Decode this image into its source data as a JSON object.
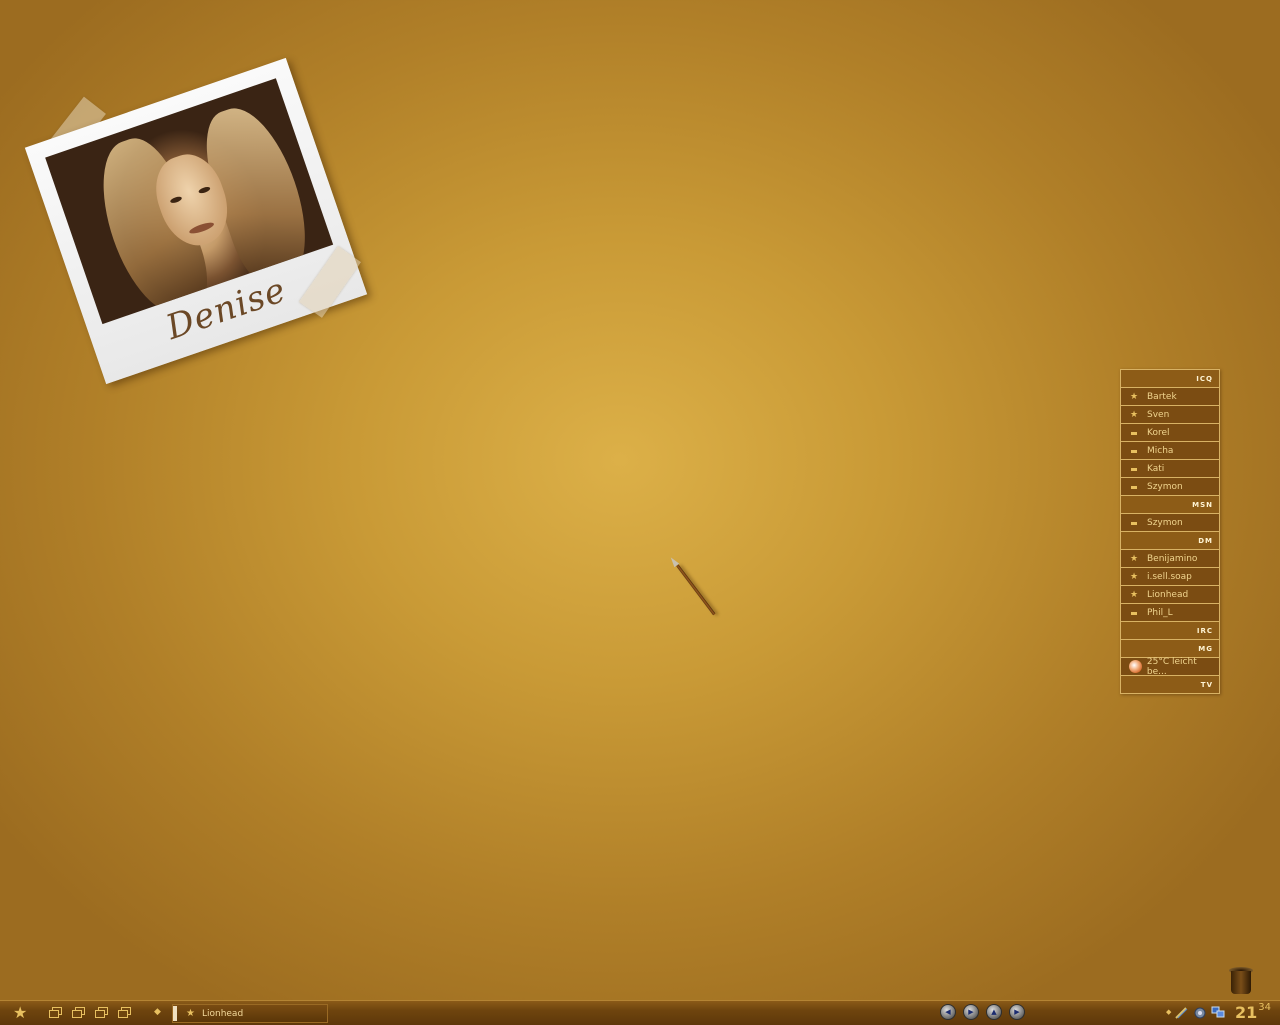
{
  "desktop": {
    "photo_caption": "Denise"
  },
  "contacts": {
    "rows": [
      {
        "type": "header",
        "label": "ICQ"
      },
      {
        "type": "contact",
        "status": "star",
        "name": "Bartek"
      },
      {
        "type": "contact",
        "status": "star",
        "name": "Sven"
      },
      {
        "type": "contact",
        "status": "away",
        "name": "Korel"
      },
      {
        "type": "contact",
        "status": "away",
        "name": "Micha"
      },
      {
        "type": "contact",
        "status": "away",
        "name": "Kati"
      },
      {
        "type": "contact",
        "status": "away",
        "name": "Szymon"
      },
      {
        "type": "header",
        "label": "MSN"
      },
      {
        "type": "contact",
        "status": "away",
        "name": "Szymon"
      },
      {
        "type": "header",
        "label": "DM"
      },
      {
        "type": "contact",
        "status": "star",
        "name": "Benijamino"
      },
      {
        "type": "contact",
        "status": "star",
        "name": "i.sell.soap"
      },
      {
        "type": "contact",
        "status": "star",
        "name": "Lionhead"
      },
      {
        "type": "contact",
        "status": "away",
        "name": "Phil_L"
      },
      {
        "type": "header",
        "label": "IRC"
      },
      {
        "type": "header",
        "label": "MG"
      },
      {
        "type": "weather",
        "name": "25°C leicht be..."
      },
      {
        "type": "header",
        "label": "TV"
      }
    ]
  },
  "taskbar": {
    "active_task": "Lionhead",
    "clock_hours": "21",
    "clock_minutes": "34",
    "icons": {
      "start": "star-icon",
      "desktops": "virtual-desktop-icon",
      "media": [
        "previous-icon",
        "play-icon",
        "eject-icon",
        "next-icon"
      ],
      "trash": "trash-bin-icon"
    }
  },
  "colors": {
    "accent": "#e8c060",
    "panel": "#7b4c12",
    "background": "#c99a36"
  }
}
